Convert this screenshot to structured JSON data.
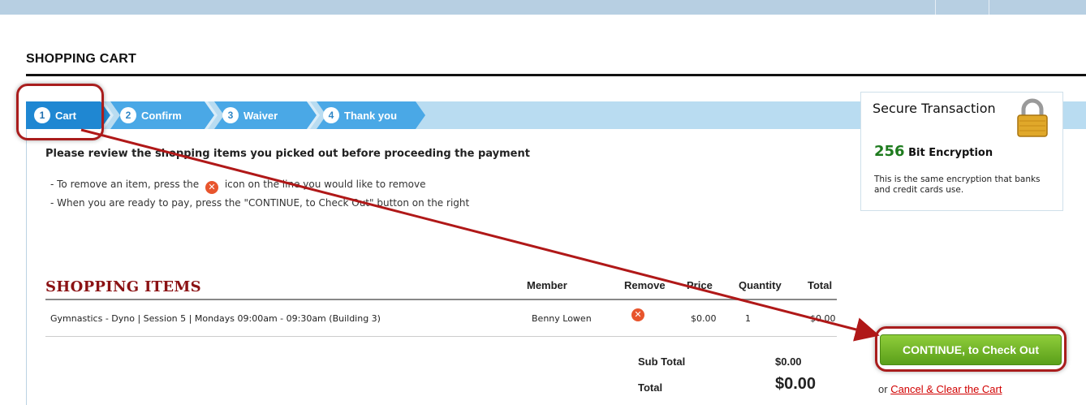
{
  "page": {
    "title": "SHOPPING CART"
  },
  "steps": [
    {
      "num": "1",
      "label": "Cart"
    },
    {
      "num": "2",
      "label": "Confirm"
    },
    {
      "num": "3",
      "label": "Waiver"
    },
    {
      "num": "4",
      "label": "Thank you"
    }
  ],
  "intro": {
    "headline": "Please review the shopping items you picked out before proceeding the payment",
    "hint1_prefix": "- To remove an item, press the",
    "hint1_suffix": "icon on the line you would like to remove",
    "hint2": "- When you are ready to pay, press the \"CONTINUE, to Check Out\" button on the right"
  },
  "secure": {
    "title": "Secure Transaction",
    "bits": "256",
    "bits_label": "Bit Encryption",
    "desc": "This is the same encryption that banks and credit cards use.",
    "icon": "padlock-icon"
  },
  "items": {
    "heading": "SHOPPING ITEMS",
    "columns": {
      "member": "Member",
      "remove": "Remove",
      "price": "Price",
      "quantity": "Quantity",
      "total": "Total"
    },
    "rows": [
      {
        "description": "Gymnastics - Dyno | Session 5 | Mondays 09:00am - 09:30am (Building 3)",
        "member": "Benny Lowen",
        "price": "$0.00",
        "quantity": "1",
        "total": "$0.00"
      }
    ]
  },
  "summary": {
    "subtotal_label": "Sub Total",
    "subtotal_value": "$0.00",
    "total_label": "Total",
    "total_value": "$0.00"
  },
  "actions": {
    "continue_label": "CONTINUE, to Check Out",
    "or_text": "or",
    "cancel_label": "Cancel & Clear the Cart"
  },
  "colors": {
    "accent_red": "#a91d1d",
    "heading_red": "#8b1214",
    "step_blue": "#b9dcf1",
    "button_green": "#6fb52a"
  }
}
